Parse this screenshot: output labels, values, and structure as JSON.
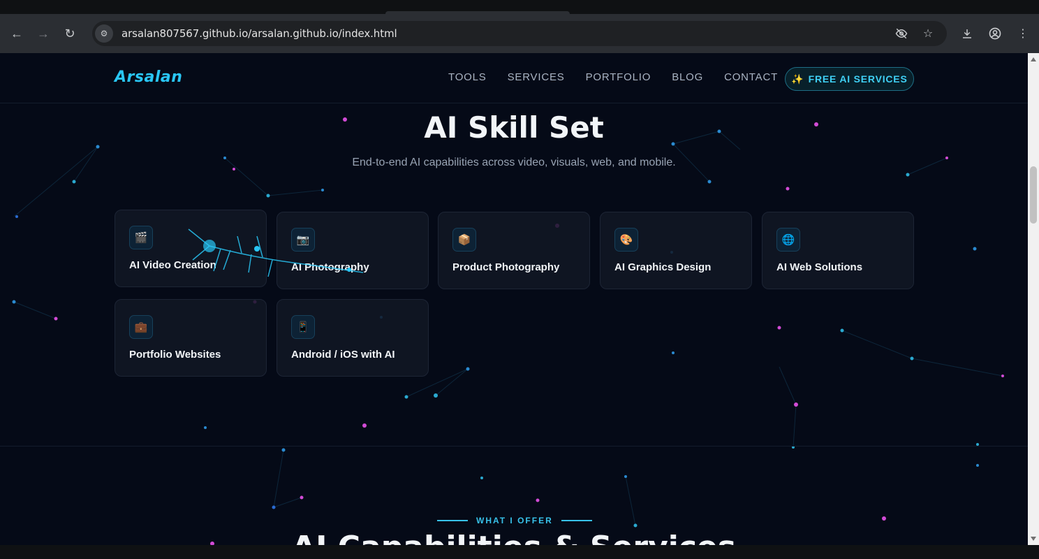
{
  "browser": {
    "url": "arsalan807567.github.io/arsalan.github.io/index.html",
    "icons": [
      "back-icon",
      "forward-icon",
      "reload-icon",
      "site-settings-icon",
      "eye-off-icon",
      "star-icon",
      "download-icon",
      "profile-icon",
      "menu-icon"
    ]
  },
  "site": {
    "logo": "Arsalan",
    "nav": [
      "TOOLS",
      "SERVICES",
      "PORTFOLIO",
      "BLOG",
      "CONTACT"
    ],
    "cta": "FREE AI SERVICES",
    "cta_icon": "✨"
  },
  "section": {
    "title": "AI Skill Set",
    "subtitle": "End-to-end AI capabilities across video, visuals, web, and mobile.",
    "cards": [
      {
        "label": "AI Video Creation",
        "icon": "🎬"
      },
      {
        "label": "AI Photography",
        "icon": "📷"
      },
      {
        "label": "Product Photography",
        "icon": "📦"
      },
      {
        "label": "AI Graphics Design",
        "icon": "🎨"
      },
      {
        "label": "AI Web Solutions",
        "icon": "🌐"
      },
      {
        "label": "Portfolio Websites",
        "icon": "💼"
      },
      {
        "label": "Android / iOS with AI",
        "icon": "📱"
      }
    ]
  },
  "next_section": {
    "eyebrow": "WHAT I OFFER",
    "title": "AI Capabilities & Services"
  },
  "colors": {
    "background": "#050a17",
    "accent": "#29c6f5",
    "magenta": "#d24bd6"
  }
}
